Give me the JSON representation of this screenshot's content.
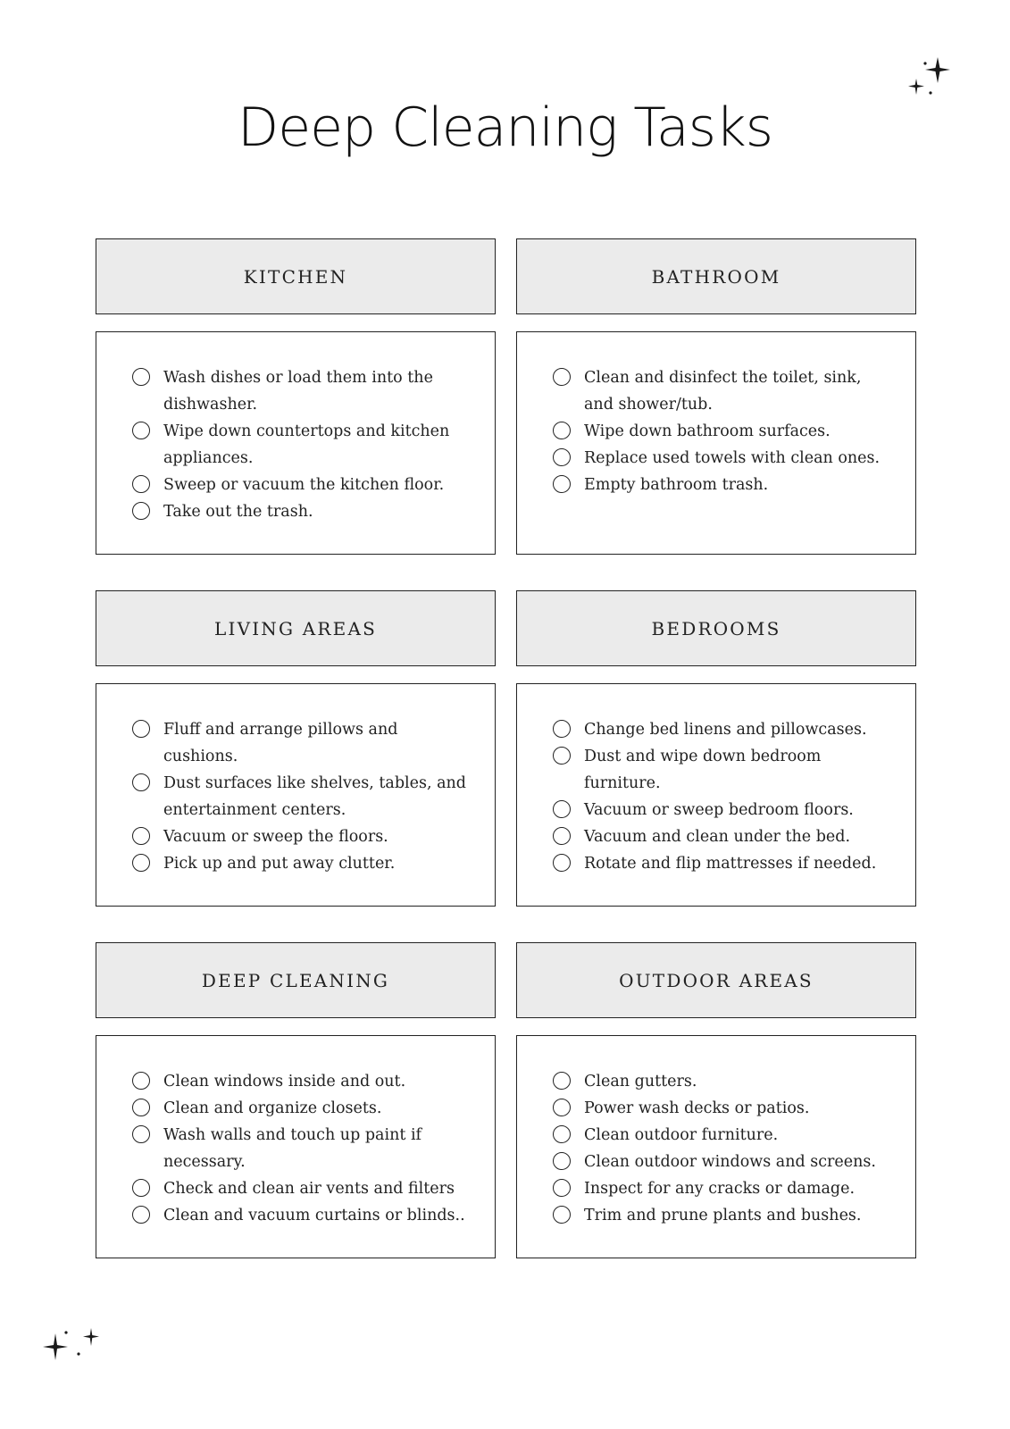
{
  "title": "Deep Cleaning Tasks",
  "sections": [
    {
      "heading": "KITCHEN",
      "tasks": [
        "Wash dishes or load them into the dishwasher.",
        "Wipe down countertops and kitchen appliances.",
        "Sweep or vacuum the kitchen floor.",
        "Take out the trash."
      ]
    },
    {
      "heading": "BATHROOM",
      "tasks": [
        "Clean and disinfect the toilet, sink, and shower/tub.",
        "Wipe down bathroom surfaces.",
        "Replace used towels with clean ones.",
        "Empty bathroom trash."
      ]
    },
    {
      "heading": "LIVING AREAS",
      "tasks": [
        "Fluff and arrange pillows and cushions.",
        "Dust surfaces like shelves, tables, and entertainment centers.",
        "Vacuum or sweep the floors.",
        "Pick up and put away clutter."
      ]
    },
    {
      "heading": "BEDROOMS",
      "tasks": [
        "Change bed linens and pillowcases.",
        "Dust and wipe down bedroom furniture.",
        "Vacuum or sweep bedroom floors.",
        "Vacuum and clean under the bed.",
        "Rotate and flip mattresses if needed."
      ]
    },
    {
      "heading": "DEEP CLEANING",
      "tasks": [
        "Clean windows inside and out.",
        "Clean and organize closets.",
        "Wash walls and touch up paint if necessary.",
        "Check and clean air vents and filters",
        "Clean and vacuum curtains or blinds.."
      ]
    },
    {
      "heading": "OUTDOOR AREAS",
      "tasks": [
        "Clean gutters.",
        "Power wash decks or patios.",
        "Clean outdoor furniture.",
        "Clean outdoor windows and screens.",
        "Inspect for any cracks or damage.",
        "Trim and prune plants and bushes."
      ]
    }
  ],
  "icons": {
    "decoration": "sparkles-icon",
    "checkbox": "circle-checkbox-icon"
  }
}
